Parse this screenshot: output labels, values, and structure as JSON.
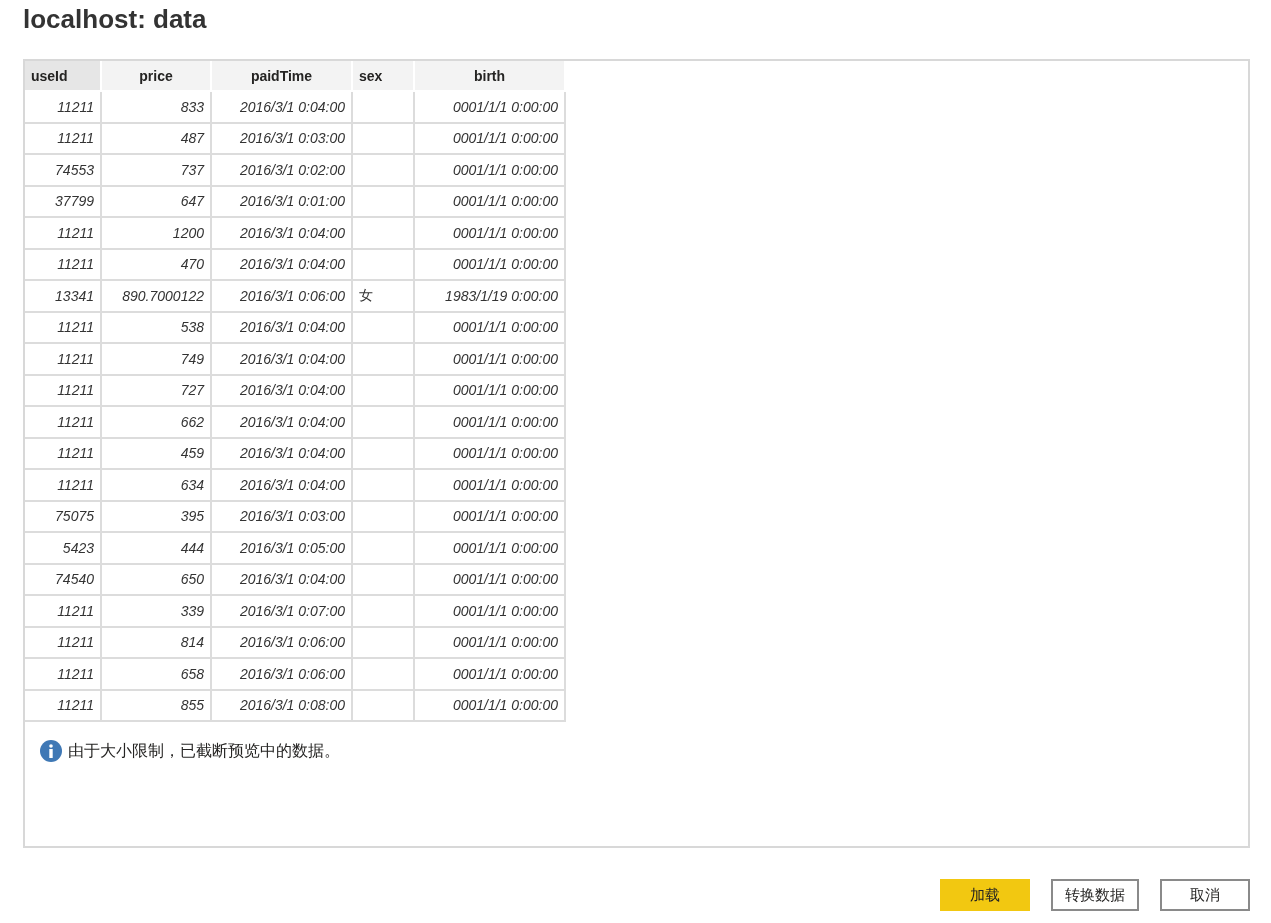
{
  "window": {
    "title": "localhost: data"
  },
  "table": {
    "columns": [
      {
        "label": "useId",
        "selected": true
      },
      {
        "label": "price",
        "selected": false
      },
      {
        "label": "paidTime",
        "selected": false
      },
      {
        "label": "sex",
        "selected": false
      },
      {
        "label": "birth",
        "selected": false
      }
    ],
    "rows": [
      [
        "11211",
        "833",
        "2016/3/1 0:04:00",
        "",
        "0001/1/1 0:00:00"
      ],
      [
        "11211",
        "487",
        "2016/3/1 0:03:00",
        "",
        "0001/1/1 0:00:00"
      ],
      [
        "74553",
        "737",
        "2016/3/1 0:02:00",
        "",
        "0001/1/1 0:00:00"
      ],
      [
        "37799",
        "647",
        "2016/3/1 0:01:00",
        "",
        "0001/1/1 0:00:00"
      ],
      [
        "11211",
        "1200",
        "2016/3/1 0:04:00",
        "",
        "0001/1/1 0:00:00"
      ],
      [
        "11211",
        "470",
        "2016/3/1 0:04:00",
        "",
        "0001/1/1 0:00:00"
      ],
      [
        "13341",
        "890.7000122",
        "2016/3/1 0:06:00",
        "女",
        "1983/1/19 0:00:00"
      ],
      [
        "11211",
        "538",
        "2016/3/1 0:04:00",
        "",
        "0001/1/1 0:00:00"
      ],
      [
        "11211",
        "749",
        "2016/3/1 0:04:00",
        "",
        "0001/1/1 0:00:00"
      ],
      [
        "11211",
        "727",
        "2016/3/1 0:04:00",
        "",
        "0001/1/1 0:00:00"
      ],
      [
        "11211",
        "662",
        "2016/3/1 0:04:00",
        "",
        "0001/1/1 0:00:00"
      ],
      [
        "11211",
        "459",
        "2016/3/1 0:04:00",
        "",
        "0001/1/1 0:00:00"
      ],
      [
        "11211",
        "634",
        "2016/3/1 0:04:00",
        "",
        "0001/1/1 0:00:00"
      ],
      [
        "75075",
        "395",
        "2016/3/1 0:03:00",
        "",
        "0001/1/1 0:00:00"
      ],
      [
        "5423",
        "444",
        "2016/3/1 0:05:00",
        "",
        "0001/1/1 0:00:00"
      ],
      [
        "74540",
        "650",
        "2016/3/1 0:04:00",
        "",
        "0001/1/1 0:00:00"
      ],
      [
        "11211",
        "339",
        "2016/3/1 0:07:00",
        "",
        "0001/1/1 0:00:00"
      ],
      [
        "11211",
        "814",
        "2016/3/1 0:06:00",
        "",
        "0001/1/1 0:00:00"
      ],
      [
        "11211",
        "658",
        "2016/3/1 0:06:00",
        "",
        "0001/1/1 0:00:00"
      ],
      [
        "11211",
        "855",
        "2016/3/1 0:08:00",
        "",
        "0001/1/1 0:00:00"
      ]
    ]
  },
  "notice": "由于大小限制，已截断预览中的数据。",
  "buttons": [
    {
      "label": "加载",
      "kind": "primary"
    },
    {
      "label": "转换数据",
      "kind": "secondary"
    },
    {
      "label": "取消",
      "kind": "secondary"
    }
  ]
}
